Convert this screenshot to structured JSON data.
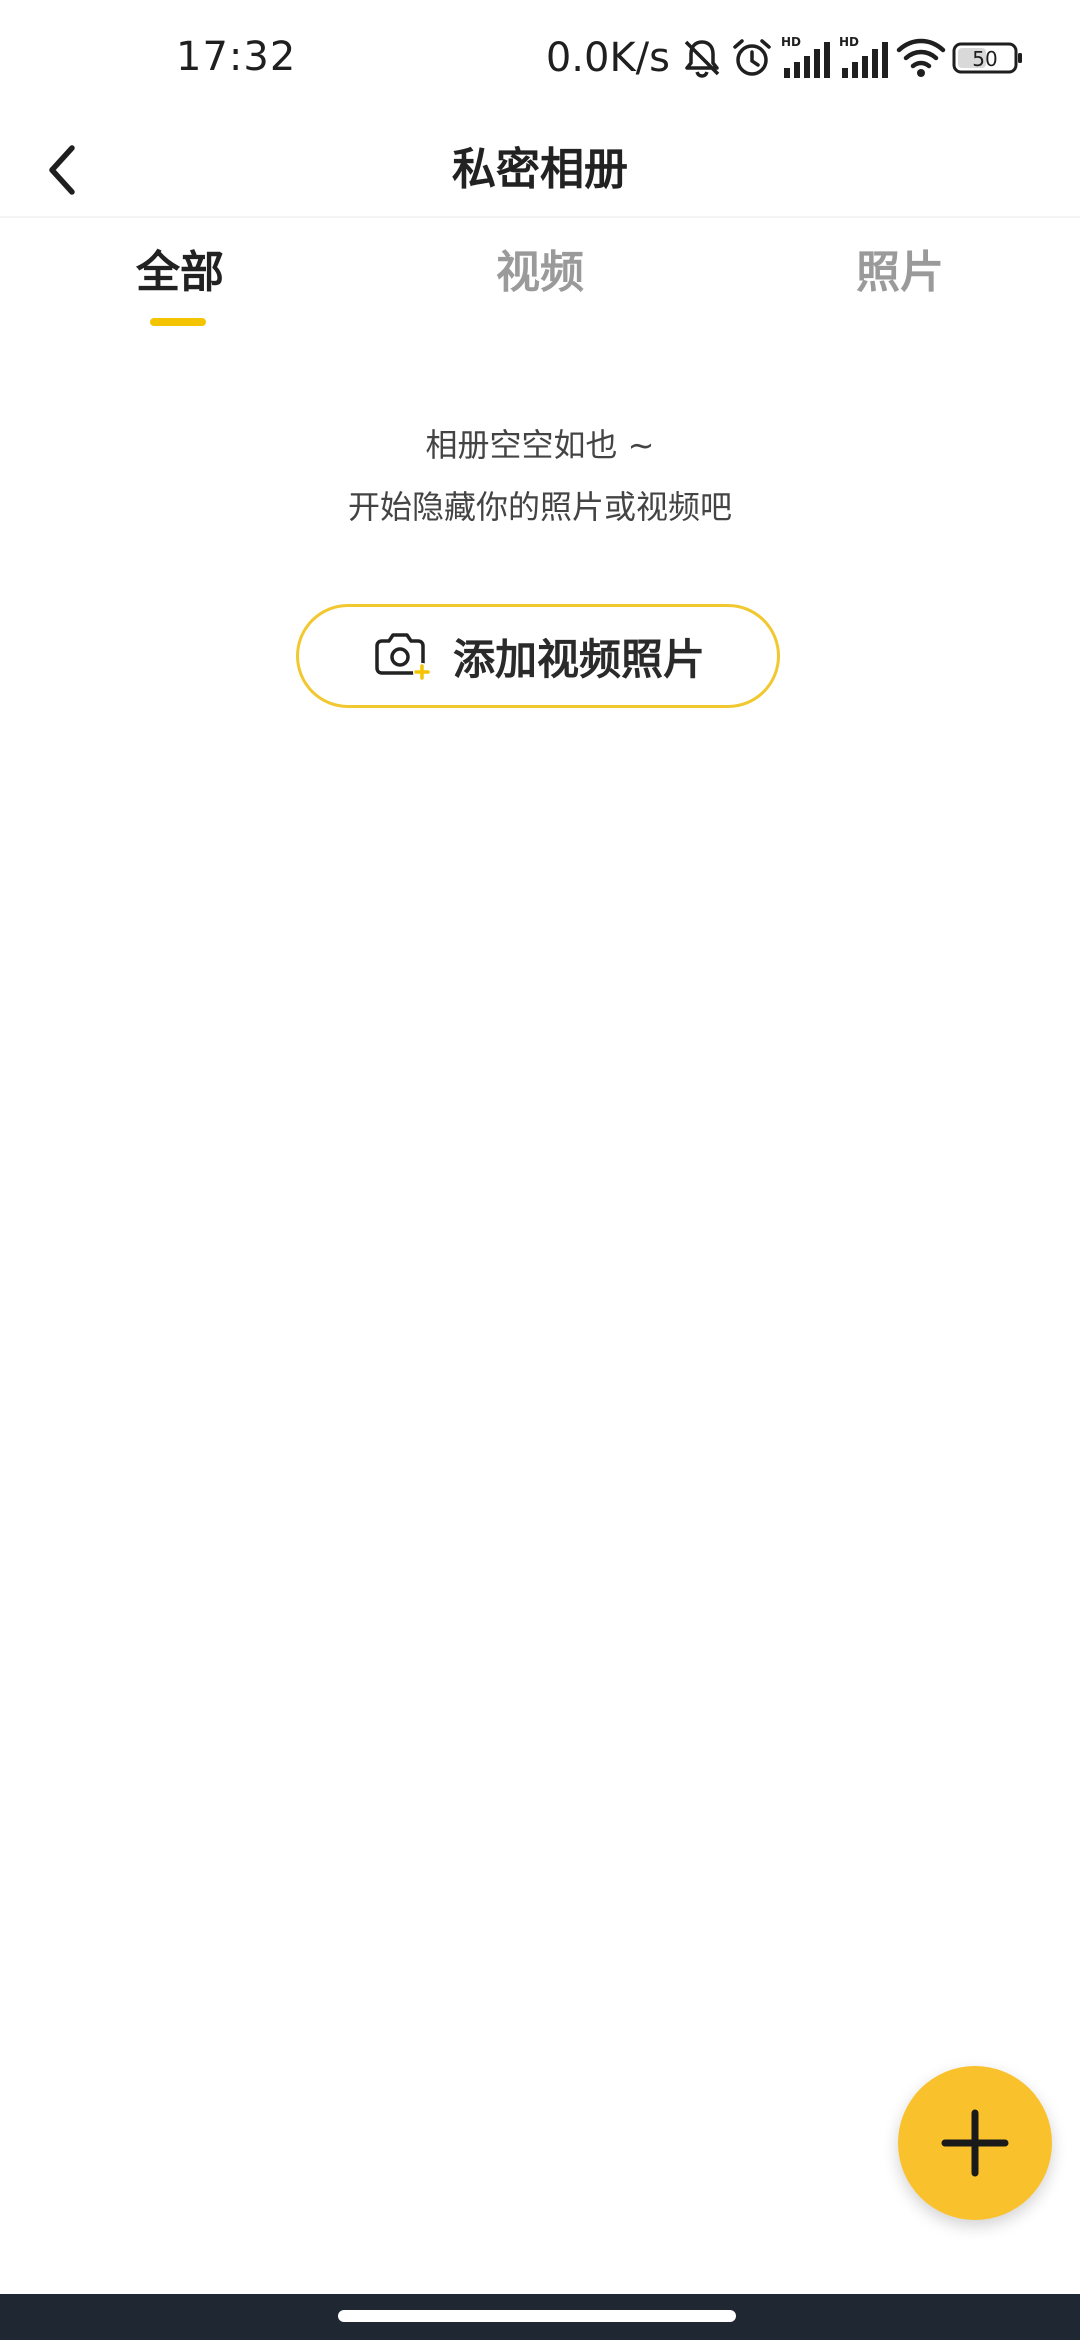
{
  "status_bar": {
    "time": "17:32",
    "net_speed": "0.0K/s",
    "signal_label_1": "HD",
    "signal_label_2": "HD",
    "battery_level": "50",
    "icons": [
      "mute-bell-icon",
      "alarm-icon",
      "signal-icon",
      "signal-icon",
      "wifi-icon",
      "battery-icon"
    ]
  },
  "header": {
    "title": "私密相册",
    "back_icon": "chevron-left-icon"
  },
  "tabs": [
    {
      "label": "全部",
      "active": true
    },
    {
      "label": "视频",
      "active": false
    },
    {
      "label": "照片",
      "active": false
    }
  ],
  "empty_state": {
    "line1": "相册空空如也 ~",
    "line2": "开始隐藏你的照片或视频吧",
    "button_label": "添加视频照片",
    "button_icon": "camera-add-icon"
  },
  "fab": {
    "icon": "plus-icon"
  },
  "colors": {
    "accent": "#f9c12c",
    "tab_indicator": "#f5c400",
    "button_border": "#f2c830",
    "nav_bar": "#1f2733"
  }
}
